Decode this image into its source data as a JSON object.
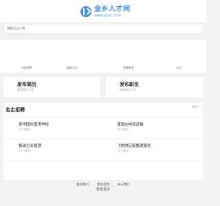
{
  "header": {
    "logo_title": "金乡人才网",
    "logo_url": "www.jxjxrc.com"
  },
  "search": {
    "placeholder": "搜职位/公司"
  },
  "quick_nav": [
    {
      "label": "小区招聘"
    },
    {
      "label": "精准点击"
    },
    {
      "label": "附属推荐"
    },
    {
      "label": "小试"
    }
  ],
  "actions": {
    "resume_title": "发布简历",
    "resume_sub": "更多职位工作",
    "job_title": "发布职位",
    "job_sub": "招贤纳士人才"
  },
  "companies": {
    "title": "名企招聘",
    "more_label": "更多 >",
    "list": [
      {
        "name": "青华园外国语学校",
        "count": "25个职位"
      },
      {
        "name": "速速达物流运输",
        "count": "18个职位"
      },
      {
        "name": "格瑞企业管理",
        "count": "10个职位"
      },
      {
        "name": "飞悦供应链管理服务",
        "count": "17个职位"
      }
    ],
    "view_more": "查看更多"
  },
  "footer": {
    "links": [
      "联系我们",
      "意见反馈",
      "关于我们"
    ]
  }
}
